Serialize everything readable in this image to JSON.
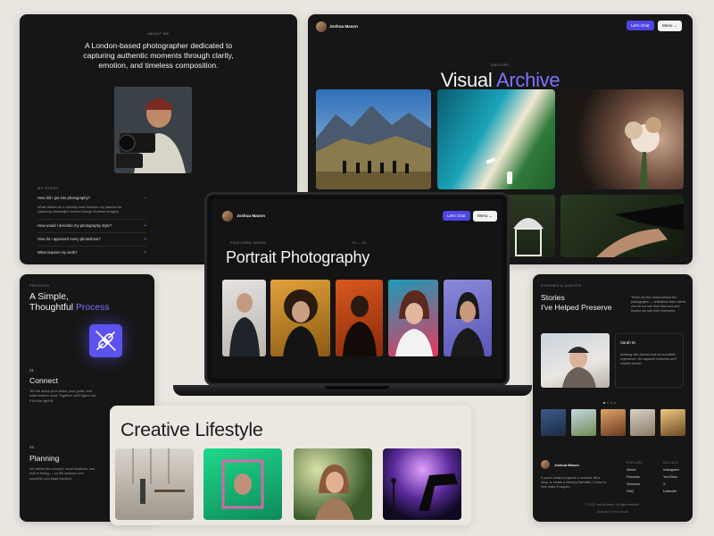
{
  "about": {
    "eyebrow": "ABOUT ME",
    "headline": "A London-based photographer dedicated to capturing authentic moments through clarity, emotion, and timeless composition.",
    "story_label": "MY STORY",
    "faqs": [
      {
        "q": "How did I get into photography?",
        "a": "What started as a curiosity soon became my passion for capturing meaningful stories through timeless imagery.",
        "mark": "−"
      },
      {
        "q": "How would I describe my photography style?",
        "mark": "+"
      },
      {
        "q": "How do I approach every photoshoot?",
        "mark": "+"
      },
      {
        "q": "What inspires my work?",
        "mark": "+"
      }
    ]
  },
  "brand": {
    "name": "Joshua Mason",
    "chat_label": "Let's Chat",
    "menu_label": "Menu",
    "accent": "#4f46e5"
  },
  "gallery": {
    "eyebrow": "GALLERY",
    "title_part1": "Visual ",
    "title_part2": "Archive"
  },
  "process": {
    "eyebrow": "PROCESS",
    "title_part1": "A Simple,",
    "title_part2": "Thoughtful ",
    "title_part3": "Process",
    "steps": [
      {
        "num": "01",
        "title": "Connect",
        "desc": "Tell me about your vision, your goals, and what matters most. Together, we'll figure out if it's the right fit."
      },
      {
        "num": "02",
        "title": "Planning",
        "desc": "We define the concept, scout locations, and lock in timing — so the session runs smoothly and stays focused."
      }
    ]
  },
  "portrait": {
    "eyebrow": "FEATURED WORK",
    "counter": "01 — 04",
    "title": "Portrait Photography"
  },
  "stories": {
    "eyebrow": "STORIES & GUESTS",
    "title_line1": "Stories",
    "title_line2": "I've Helped Preserve",
    "desc": "These are the voices behind the photographs — reflections from clients who let me into their lives and and trusted me with their memories.",
    "quote_name": "Sarah M.",
    "quote_text": "Working with Joshua was an incredible experience. He captured moments we'll cherish forever.",
    "footer_desc": "If you're ready to capture a moment, tell a story, or create a memory that lasts, I'd love to help make it happen.",
    "explore_label": "EXPLORE",
    "socials_label": "SOCIALS",
    "explore_links": [
      "About",
      "Process",
      "Services",
      "FAQ"
    ],
    "social_links": [
      "Instagram",
      "YouTube",
      "X",
      "LinkedIn"
    ],
    "copyright": "© 2025, Joshua Mason. All rights reserved.",
    "designer": "Designed by Pixel Studio"
  },
  "lifestyle": {
    "title": "Creative Lifestyle"
  }
}
